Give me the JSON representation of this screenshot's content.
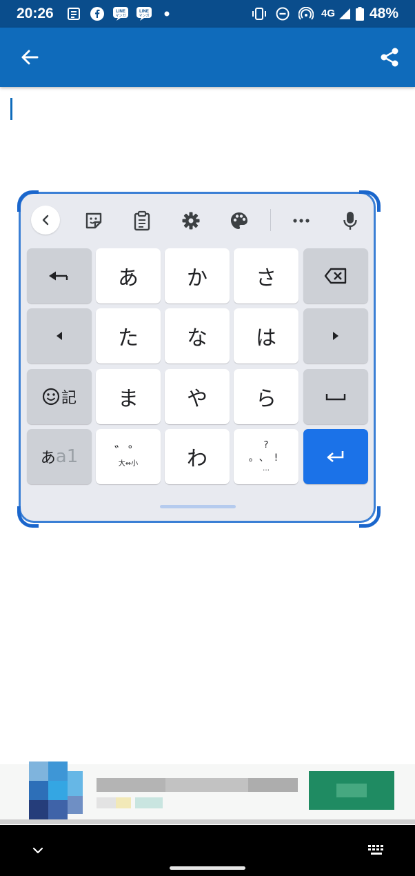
{
  "status_bar": {
    "time": "20:26",
    "network": "4G",
    "battery": "48%",
    "notification_icons": [
      "news-icon",
      "facebook-icon",
      "line-manga-icon",
      "line-manga-icon",
      "dot-icon"
    ],
    "system_icons": [
      "vibrate-icon",
      "do-not-disturb-icon",
      "hotspot-icon",
      "signal-icon",
      "battery-icon"
    ]
  },
  "app_bar": {
    "color": "#0f6bbb",
    "left_icon": "back-arrow-icon",
    "right_icon": "share-icon"
  },
  "keyboard": {
    "accent": "#1b72e8",
    "toolbar_icons": [
      "chevron-left-icon",
      "sticker-icon",
      "clipboard-icon",
      "settings-icon",
      "palette-icon",
      "more-icon",
      "microphone-icon"
    ],
    "keys": {
      "a": "あ",
      "ka": "か",
      "sa": "さ",
      "ta": "た",
      "na": "な",
      "ha": "は",
      "ma": "ま",
      "ya": "や",
      "ra": "ら",
      "wa": "わ",
      "emoji_symbol_label": "記",
      "mode_hiragana": "あ",
      "mode_alpha": "a1",
      "dakuten_top": "゛゜",
      "dakuten_bottom": "大⇔小",
      "punct_top": "?",
      "punct_middle": "。、!",
      "punct_bottom": "…"
    }
  },
  "nav_bar": {
    "left_icon": "chevron-down-icon",
    "right_icon": "keyboard-icon"
  }
}
